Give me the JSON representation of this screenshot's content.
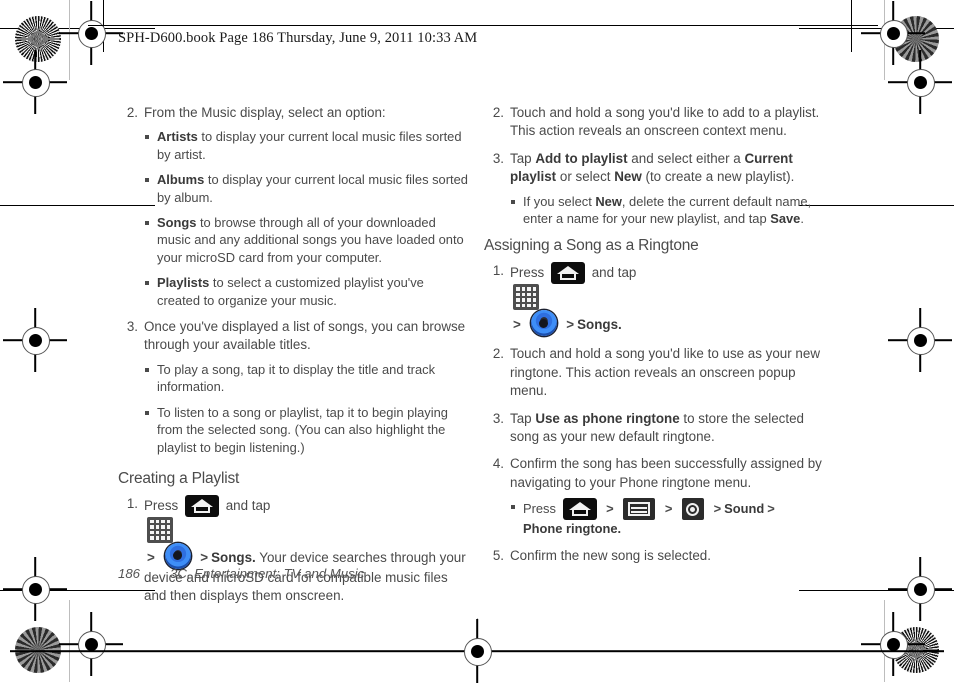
{
  "header": {
    "text": "SPH-D600.book  Page 186  Thursday, June 9, 2011  10:33 AM"
  },
  "footer": {
    "page_number": "186",
    "chapter_title": "3C. Entertainment: TV and Music"
  },
  "icons": {
    "home": "home-icon",
    "apps": "apps-grid-icon",
    "music": "music-player-icon",
    "menu": "menu-icon",
    "settings": "settings-icon",
    "separator": ">"
  },
  "left_column": {
    "step2": {
      "num": "2.",
      "text": "From the Music display, select an option:",
      "bullets": [
        {
          "bold": "Artists",
          "rest": " to display your current local music files sorted by artist."
        },
        {
          "bold": "Albums",
          "rest": " to display your current local music files sorted by album."
        },
        {
          "bold": "Songs",
          "rest": " to browse through all of your downloaded music and any additional songs you have loaded onto your microSD card from your computer."
        },
        {
          "bold": "Playlists",
          "rest": " to select a customized playlist you've created to organize your music."
        }
      ]
    },
    "step3": {
      "num": "3.",
      "text": "Once you've displayed a list of songs, you can browse through your available titles.",
      "bullets": [
        {
          "bold": "",
          "rest": "To play a song, tap it to display the title and track information."
        },
        {
          "bold": "",
          "rest": "To listen to a song or playlist, tap it to begin playing from the selected song. (You can also highlight the playlist to begin listening.)"
        }
      ]
    },
    "section_heading": "Creating a Playlist",
    "step1": {
      "num": "1.",
      "press_label": "Press",
      "and_tap_label": "and tap",
      "songs_label": "Songs.",
      "trailing": " Your device searches through your device and microSD card for compatible music files and then displays them onscreen."
    }
  },
  "right_column": {
    "step2": {
      "num": "2.",
      "text": "Touch and hold a song you'd like to add to a playlist. This action reveals an onscreen context menu."
    },
    "step3": {
      "num": "3.",
      "pre": "Tap ",
      "b1": "Add to playlist",
      "mid": " and select either a ",
      "b2": "Current playlist",
      "mid2": " or select ",
      "b3": "New",
      "post": " (to create a new playlist).",
      "bullet": {
        "pre": "If you select ",
        "b1": "New",
        "mid": ", delete the current default name, enter a name for your new playlist, and tap ",
        "b2": "Save",
        "post": "."
      }
    },
    "section_heading": "Assigning a Song as a Ringtone",
    "r_step1": {
      "num": "1.",
      "press_label": "Press",
      "and_tap_label": "and tap",
      "songs_label": "Songs."
    },
    "r_step2": {
      "num": "2.",
      "text": "Touch and hold a song you'd like to use as your new ringtone. This action reveals an onscreen popup menu."
    },
    "r_step3": {
      "num": "3.",
      "pre": "Tap ",
      "b1": "Use as phone ringtone",
      "post": " to store the selected song as your new default ringtone."
    },
    "r_step4": {
      "num": "4.",
      "text": "Confirm the song has been successfully assigned by navigating to your Phone ringtone menu.",
      "bullet": {
        "press_label": "Press",
        "sound_label": "Sound",
        "ringtone_label": "Phone ringtone."
      }
    },
    "r_step5": {
      "num": "5.",
      "text": "Confirm the new song is selected."
    }
  }
}
